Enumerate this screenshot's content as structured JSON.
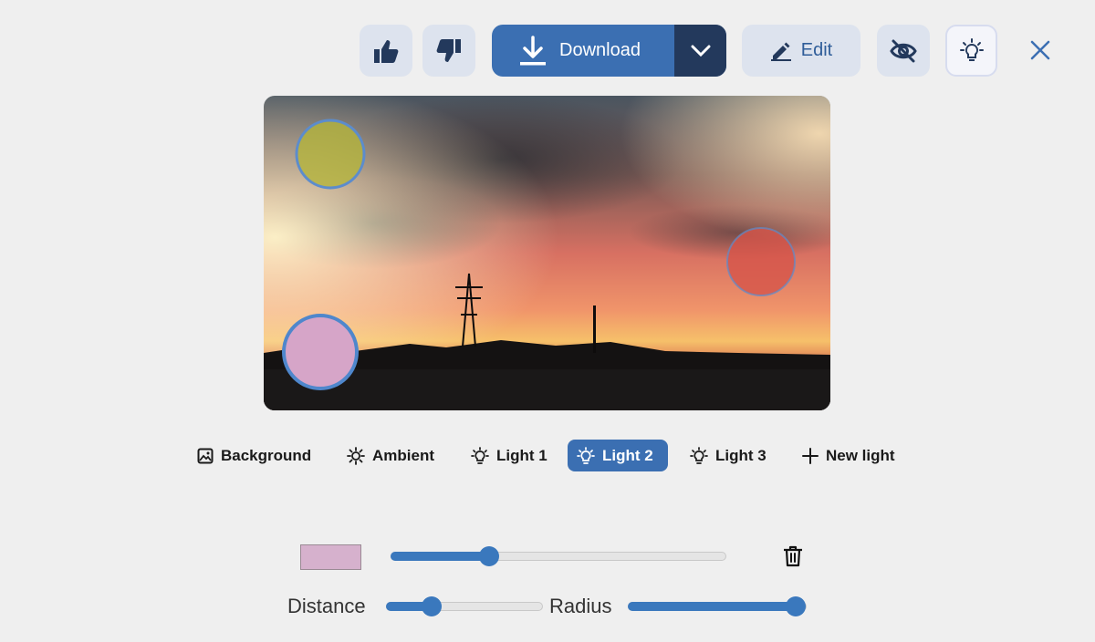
{
  "toolbar": {
    "like_icon": "thumbs-up-icon",
    "dislike_icon": "thumbs-down-icon",
    "download_label": "Download",
    "download_icon": "download-icon",
    "dropdown_icon": "chevron-down-icon",
    "edit_label": "Edit",
    "edit_icon": "pencil-icon",
    "hide_icon": "eye-off-icon",
    "light_icon": "lightbulb-icon",
    "close_icon": "close-icon"
  },
  "image": {
    "description_icon": "sunset-photo",
    "light_markers": [
      {
        "name": "light-1",
        "color": "#b4b43c"
      },
      {
        "name": "light-2",
        "color": "#d6a5c8"
      },
      {
        "name": "light-3",
        "color": "#d6554a"
      }
    ]
  },
  "tabs": [
    {
      "label": "Background",
      "icon": "image-icon",
      "active": false
    },
    {
      "label": "Ambient",
      "icon": "sun-icon",
      "active": false
    },
    {
      "label": "Light 1",
      "icon": "lightbulb-icon",
      "active": false
    },
    {
      "label": "Light 2",
      "icon": "lightbulb-icon",
      "active": true
    },
    {
      "label": "Light 3",
      "icon": "lightbulb-icon",
      "active": false
    },
    {
      "label": "New light",
      "icon": "plus-icon",
      "active": false
    }
  ],
  "controls": {
    "color_swatch": "#d6b1cd",
    "intensity_fraction": 0.28,
    "delete_icon": "trash-icon",
    "distance_label": "Distance",
    "distance_fraction": 0.26,
    "radius_label": "Radius",
    "radius_fraction": 1.0
  },
  "colors": {
    "accent": "#3b6fb2",
    "accent_dark": "#23395c",
    "button_bg": "#dde3ee"
  }
}
